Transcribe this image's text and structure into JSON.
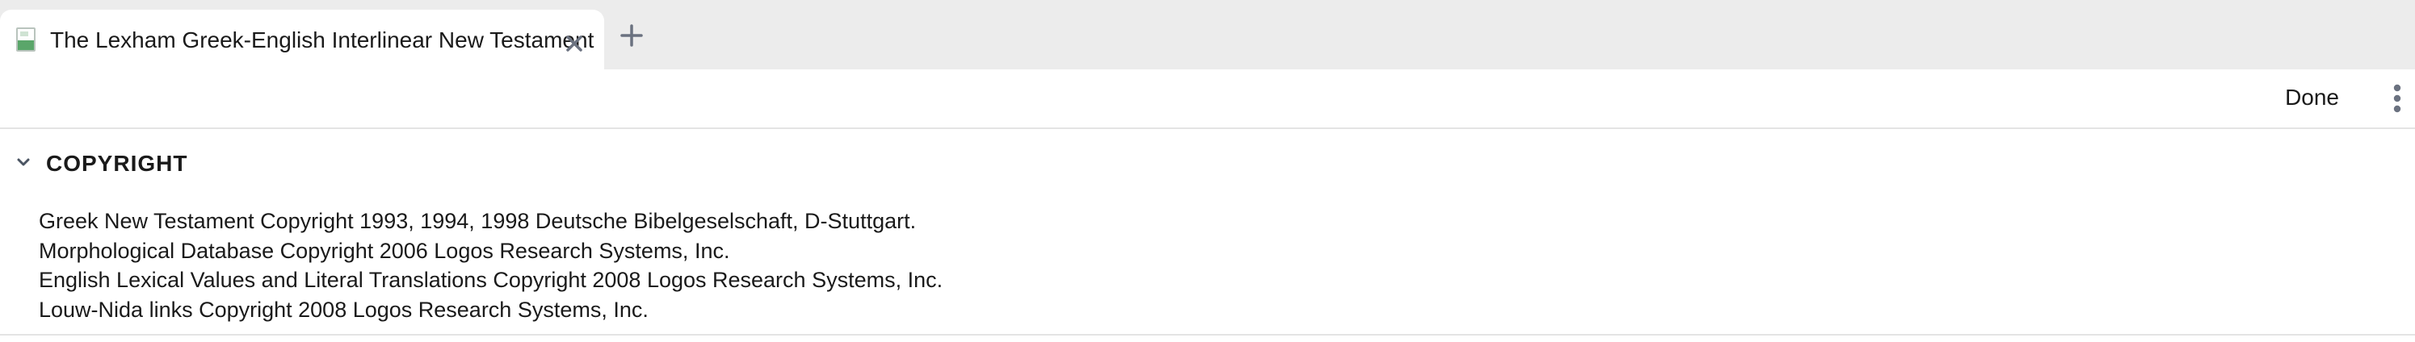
{
  "tab": {
    "title": "The Lexham Greek-English Interlinear New Testament",
    "icon": "book-icon",
    "close_icon": "close-icon",
    "new_tab_icon": "plus-icon"
  },
  "toolbar": {
    "done_label": "Done",
    "menu_icon": "vertical-ellipsis-icon"
  },
  "section": {
    "title": "COPYRIGHT",
    "expanded": true,
    "lines": [
      "Greek New Testament Copyright 1993, 1994, 1998 Deutsche Bibelgeselschaft, D-Stuttgart.",
      "Morphological Database Copyright 2006 Logos Research Systems, Inc.",
      "English Lexical Values and Literal Translations Copyright 2008 Logos Research Systems, Inc.",
      "Louw-Nida links Copyright 2008 Logos Research Systems, Inc."
    ]
  },
  "colors": {
    "tabbar_bg": "#ececec",
    "icon_accent": "#5aa66a",
    "icon_gray": "#6b7280",
    "text": "#1a1a1a"
  }
}
